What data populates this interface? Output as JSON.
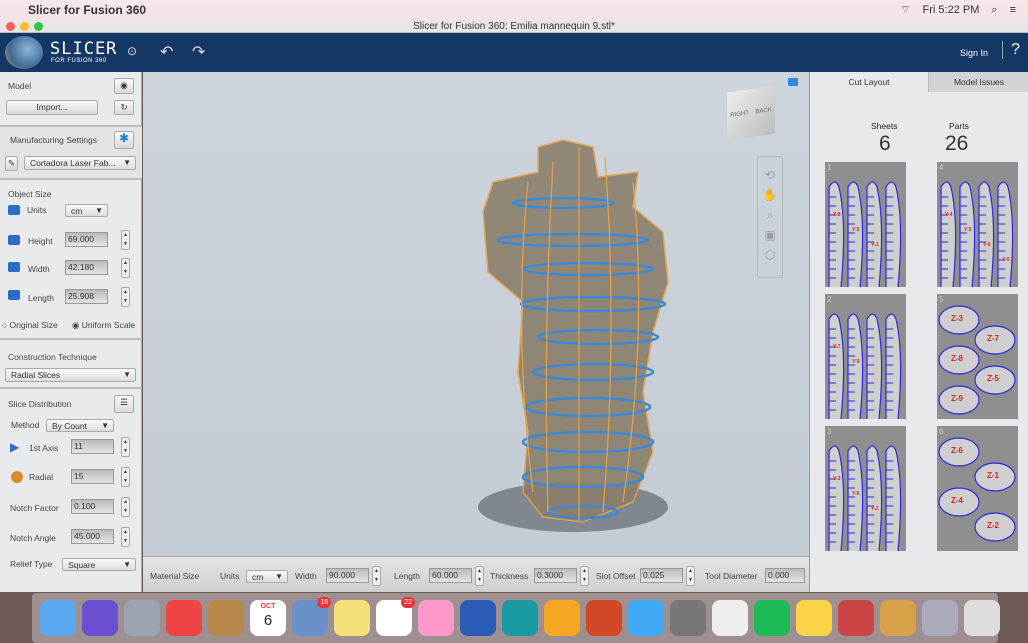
{
  "menubar": {
    "app_name": "Slicer for Fusion 360",
    "clock": "Fri 5:22 PM"
  },
  "window": {
    "title": "Slicer for Fusion 360: Emilia mannequin 9.stl*"
  },
  "header": {
    "logo_title": "SLICER",
    "logo_subtitle": "FOR FUSION 360",
    "sign_in": "Sign In",
    "help": "?"
  },
  "left": {
    "model_label": "Model",
    "import_label": "Import...",
    "manufacturing_label": "Manufacturing Settings",
    "machine": "Cortadora Laser Fab...",
    "object_size_label": "Object Size",
    "units_label": "Units",
    "units": "cm",
    "height_label": "Height",
    "height": "69.000",
    "width_label": "Width",
    "width": "42.180",
    "length_label": "Length",
    "length": "25.908",
    "original_size": "Original Size",
    "uniform_scale": "Uniform Scale",
    "construction_label": "Construction Technique",
    "technique": "Radial Slices",
    "slice_dist_label": "Slice Distribution",
    "method_label": "Method",
    "method": "By Count",
    "axis1_label": "1st Axis",
    "axis1": "11",
    "radial_label": "Radial",
    "radial": "15",
    "notch_factor_label": "Notch Factor",
    "notch_factor": "0.100",
    "notch_angle_label": "Notch Angle",
    "notch_angle": "45.000",
    "relief_label": "Relief Type",
    "relief": "Square"
  },
  "viewcube": {
    "right": "RIGHT",
    "back": "BACK"
  },
  "bottom": {
    "material_size": "Material Size",
    "units_label": "Units",
    "units": "cm",
    "width_label": "Width",
    "width": "90.000",
    "length_label": "Length",
    "length": "60.000",
    "thickness_label": "Thickness",
    "thickness": "0.3000",
    "slot_offset_label": "Slot Offset",
    "slot_offset": "0.025",
    "tool_diameter_label": "Tool Diameter",
    "tool_diameter": "0.000"
  },
  "right": {
    "tabs": [
      "Cut Layout",
      "Model Issues"
    ],
    "sheets_label": "Sheets",
    "sheets": "6",
    "parts_label": "Parts",
    "parts": "26",
    "sheet_items": [
      {
        "n": "1",
        "type": "ribs",
        "labels": [
          "Y-8",
          "Y-5",
          "Y-1"
        ]
      },
      {
        "n": "2",
        "type": "ribs",
        "labels": [
          "Y-7",
          "Y-9"
        ]
      },
      {
        "n": "3",
        "type": "ribs",
        "labels": [
          "Y-3",
          "Y-6",
          "Y-2"
        ]
      },
      {
        "n": "4",
        "type": "ribs",
        "labels": [
          "Y-4",
          "Y-5",
          "Y-6",
          "Y-0"
        ]
      },
      {
        "n": "5",
        "type": "discs",
        "labels": [
          "Z-3",
          "Z-7",
          "Z-8",
          "Z-5",
          "Z-9"
        ]
      },
      {
        "n": "6",
        "type": "discs",
        "labels": [
          "Z-6",
          "Z-1",
          "Z-4",
          "Z-2"
        ]
      }
    ]
  },
  "colors": {
    "header": "#143766",
    "slice_blue": "#2a2ae0",
    "label_red": "#e02020"
  },
  "dock": {
    "apps": [
      "finder",
      "siri",
      "launchpad",
      "chrome",
      "contacts",
      "calendar",
      "preview",
      "notes",
      "reminders",
      "photos",
      "word",
      "arduino",
      "sketch",
      "powerpoint",
      "messages",
      "system-preferences",
      "mosaic",
      "spotify",
      "tips",
      "fusion",
      "slicer",
      "utilities",
      "trash"
    ],
    "calendar_day": "6",
    "calendar_month": "OCT",
    "badge_preview": "18",
    "badge_reminders": "22"
  }
}
